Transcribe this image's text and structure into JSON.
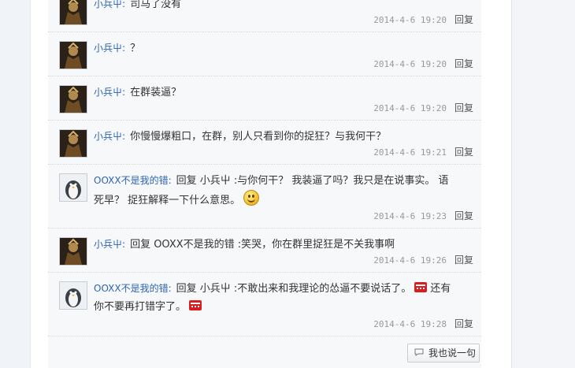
{
  "replies": [
    {
      "user": "小兵屮",
      "text": "司马了没有",
      "time": "2014-4-6 19:20",
      "reply_label": "回复",
      "avatar": "warrior-avatar"
    },
    {
      "user": "小兵屮",
      "text": "？",
      "time": "2014-4-6 19:20",
      "reply_label": "回复",
      "avatar": "warrior-avatar"
    },
    {
      "user": "小兵屮",
      "text": "在群装逼？",
      "time": "2014-4-6 19:20",
      "reply_label": "回复",
      "avatar": "warrior-avatar"
    },
    {
      "user": "小兵屮",
      "text": "你慢慢爆粗口，在群，别人只看到你的捉狂？与我何干？",
      "time": "2014-4-6 19:21",
      "reply_label": "回复",
      "avatar": "warrior-avatar"
    },
    {
      "user": "OOXX不是我的错",
      "text_line1": "回复 小兵屮 :与你何干？ 我装逼了吗？我只是在说事实。 语",
      "text_line2": "死早？ 捉狂解释一下什么意思。",
      "emoji": "smile-emoji",
      "time": "2014-4-6 19:23",
      "reply_label": "回复",
      "avatar": "penguin-avatar"
    },
    {
      "user": "小兵屮",
      "text": "回复 OOXX不是我的错 :笑哭，你在群里捉狂是不关我事啊",
      "time": "2014-4-6 19:26",
      "reply_label": "回复",
      "avatar": "warrior-avatar"
    },
    {
      "user": "OOXX不是我的错",
      "text_line1": "回复 小兵屮 :不敢出来和我理论的怂逼不要说话了。",
      "emoji1": "red-angry-emoji",
      "text_line1b": "还有",
      "text_line2": "你不要再打错字了。",
      "emoji2": "red-angry-emoji",
      "time": "2014-4-6 19:28",
      "reply_label": "回复",
      "avatar": "penguin-avatar"
    }
  ],
  "say_button": {
    "label": "我也说一句",
    "icon": "comment-icon"
  },
  "colors": {
    "username": "#2d64b3",
    "meta": "#999999",
    "panel": "#f7f8fa"
  }
}
